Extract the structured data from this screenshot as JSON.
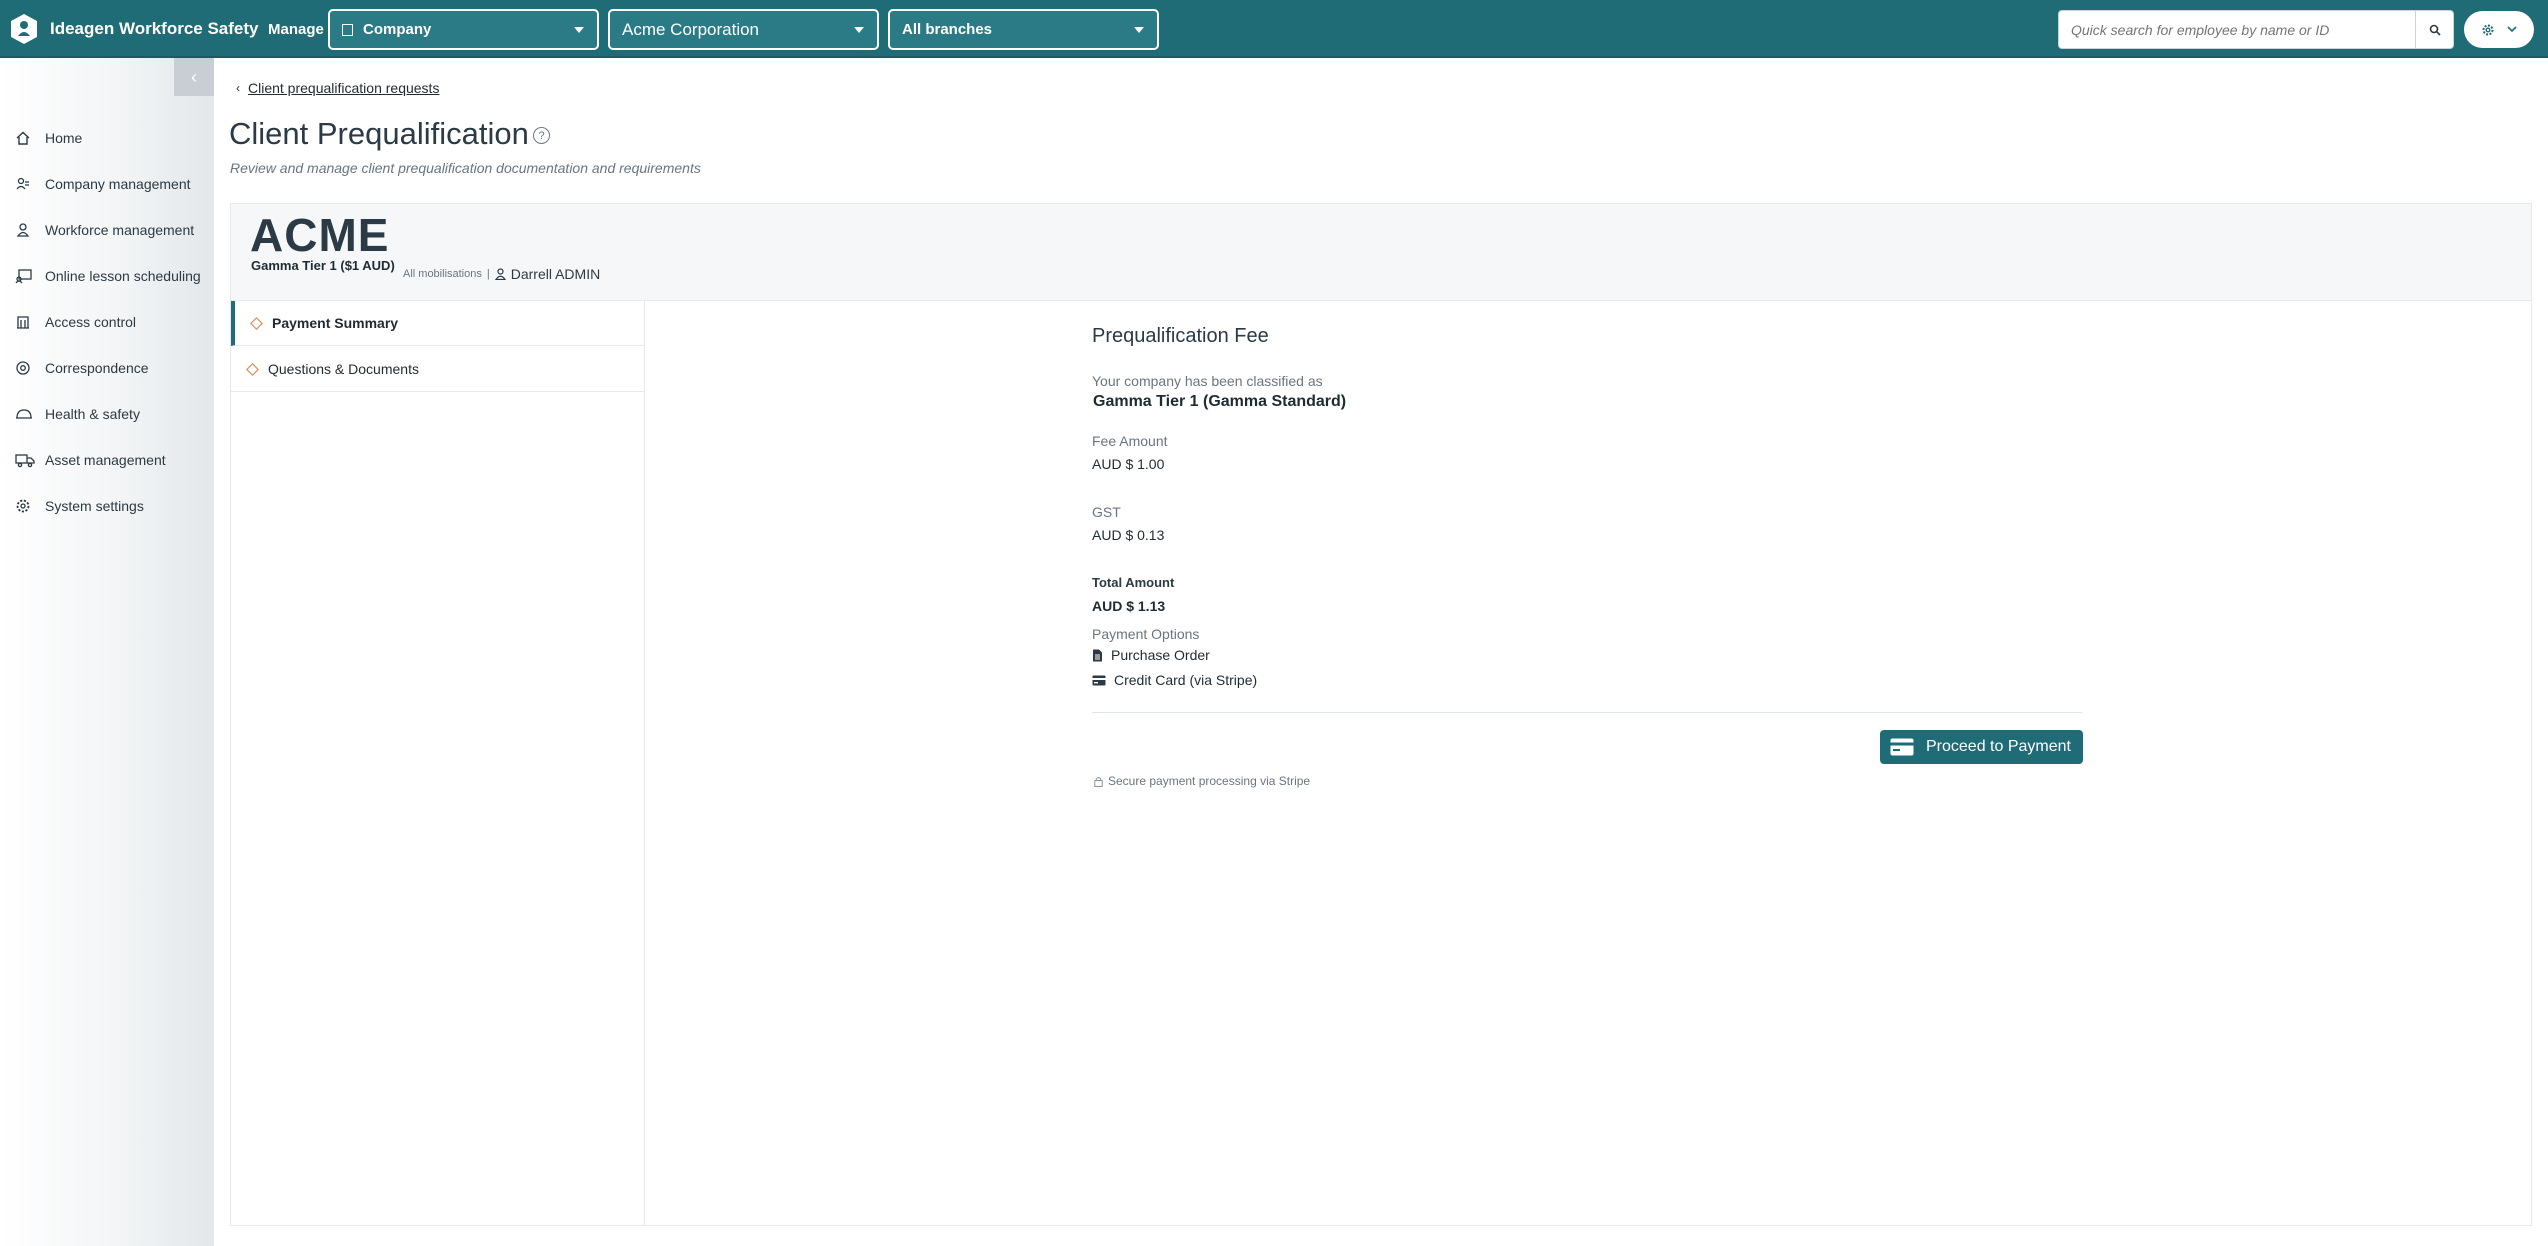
{
  "header": {
    "app_title": "Ideagen Workforce Safety",
    "manage_label": "Manage",
    "company_select": "Company",
    "org_select": "Acme Corporation",
    "branch_select": "All branches",
    "search_placeholder": "Quick search for employee by name or ID",
    "brand_color": "#1f6b76"
  },
  "sidebar": {
    "items": [
      {
        "label": "Home",
        "icon": "home-icon"
      },
      {
        "label": "Company management",
        "icon": "company-icon"
      },
      {
        "label": "Workforce management",
        "icon": "user-icon"
      },
      {
        "label": "Online lesson scheduling",
        "icon": "lesson-icon"
      },
      {
        "label": "Access control",
        "icon": "access-icon"
      },
      {
        "label": "Correspondence",
        "icon": "at-icon"
      },
      {
        "label": "Health & safety",
        "icon": "helmet-icon"
      },
      {
        "label": "Asset management",
        "icon": "truck-icon"
      },
      {
        "label": "System settings",
        "icon": "gear-icon"
      }
    ]
  },
  "breadcrumb": {
    "back_label": "Client prequalification requests"
  },
  "page": {
    "title": "Client Prequalification",
    "subtitle": "Review and manage client prequalification documentation and requirements"
  },
  "client": {
    "name": "ACME",
    "tier": "Gamma Tier 1 ($1 AUD)",
    "mobilisations": "All mobilisations",
    "separator": "|",
    "user": "Darrell ADMIN"
  },
  "tabs": [
    {
      "label": "Payment Summary"
    },
    {
      "label": "Questions & Documents"
    }
  ],
  "fee": {
    "title": "Prequalification Fee",
    "classified_label": "Your company has been classified as",
    "classified_value": "Gamma Tier 1 (Gamma Standard)",
    "fee_label": "Fee Amount",
    "fee_value": "AUD $ 1.00",
    "gst_label": "GST",
    "gst_value": "AUD $ 0.13",
    "total_label": "Total Amount",
    "total_value": "AUD $ 1.13",
    "options_label": "Payment Options",
    "option_po": "Purchase Order",
    "option_cc": "Credit Card (via Stripe)",
    "button": "Proceed to Payment",
    "secure_note": "Secure payment processing via Stripe"
  }
}
